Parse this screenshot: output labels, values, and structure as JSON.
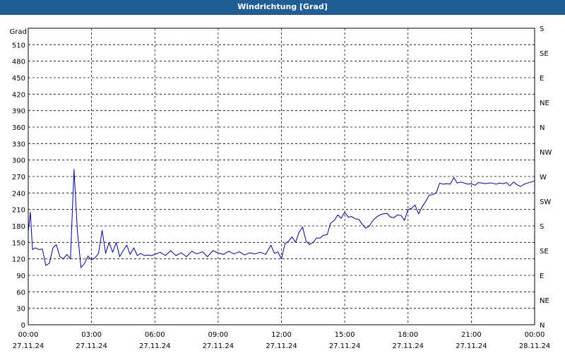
{
  "window": {
    "title": "Windrichtung [Grad]"
  },
  "chart_data": {
    "type": "line",
    "ylabel": "Grad",
    "ylim": [
      0,
      540
    ],
    "yticks": [
      0,
      30,
      60,
      90,
      120,
      150,
      180,
      210,
      240,
      270,
      300,
      330,
      360,
      390,
      420,
      450,
      480,
      510
    ],
    "right_axis_labels": [
      "N",
      "NE",
      "E",
      "SE",
      "S",
      "SW",
      "W",
      "NW",
      "N",
      "NE",
      "E",
      "SE",
      "S"
    ],
    "xlim_hours": [
      0,
      24
    ],
    "xticks": [
      {
        "hour": 0,
        "time": "00:00",
        "date": "27.11.24"
      },
      {
        "hour": 3,
        "time": "03:00",
        "date": "27.11.24"
      },
      {
        "hour": 6,
        "time": "06:00",
        "date": "27.11.24"
      },
      {
        "hour": 9,
        "time": "09:00",
        "date": "27.11.24"
      },
      {
        "hour": 12,
        "time": "12:00",
        "date": "27.11.24"
      },
      {
        "hour": 15,
        "time": "15:00",
        "date": "27.11.24"
      },
      {
        "hour": 18,
        "time": "18:00",
        "date": "27.11.24"
      },
      {
        "hour": 21,
        "time": "21:00",
        "date": "27.11.24"
      },
      {
        "hour": 24,
        "time": "00:00",
        "date": "28.11.24"
      }
    ],
    "grid": true,
    "line_color": "#00008b",
    "series": [
      {
        "x": [
          0,
          0.1,
          0.2,
          0.33,
          0.5,
          0.67,
          0.83,
          1.0,
          1.17,
          1.33,
          1.5,
          1.67,
          1.83,
          2.0,
          2.17,
          2.33,
          2.5,
          2.67,
          2.83,
          3.0,
          3.17,
          3.33,
          3.5,
          3.67,
          3.83,
          4.0,
          4.17,
          4.33,
          4.5,
          4.67,
          4.83,
          5.0,
          5.17,
          5.33,
          5.5,
          5.67,
          5.83,
          6.0,
          6.25,
          6.5,
          6.75,
          7.0,
          7.25,
          7.5,
          7.75,
          8.0,
          8.25,
          8.5,
          8.75,
          9.0,
          9.25,
          9.5,
          9.75,
          10.0,
          10.25,
          10.5,
          10.75,
          11.0,
          11.25,
          11.5,
          11.67,
          11.83,
          12.0,
          12.17,
          12.33,
          12.5,
          12.67,
          12.83,
          13.0,
          13.17,
          13.33,
          13.5,
          13.67,
          13.83,
          14.0,
          14.17,
          14.33,
          14.5,
          14.67,
          14.83,
          15.0,
          15.17,
          15.33,
          15.5,
          15.67,
          15.83,
          16.0,
          16.17,
          16.33,
          16.5,
          16.67,
          16.83,
          17.0,
          17.17,
          17.33,
          17.5,
          17.67,
          17.83,
          18.0,
          18.17,
          18.33,
          18.5,
          18.67,
          18.83,
          19.0,
          19.17,
          19.33,
          19.5,
          19.67,
          19.83,
          20.0,
          20.17,
          20.33,
          20.5,
          20.67,
          20.83,
          21.0,
          21.17,
          21.33,
          21.5,
          21.67,
          21.83,
          22.0,
          22.17,
          22.33,
          22.5,
          22.67,
          22.83,
          23.0,
          23.17,
          23.33,
          23.5,
          23.67,
          23.83,
          24.0
        ],
        "y": [
          170,
          205,
          137,
          140,
          137,
          138,
          108,
          112,
          140,
          146,
          124,
          120,
          128,
          120,
          283,
          170,
          104,
          112,
          125,
          118,
          122,
          130,
          172,
          130,
          150,
          132,
          150,
          124,
          135,
          145,
          128,
          140,
          126,
          130,
          126,
          127,
          126,
          128,
          132,
          126,
          135,
          126,
          131,
          124,
          134,
          129,
          133,
          124,
          135,
          131,
          128,
          134,
          129,
          133,
          127,
          131,
          129,
          132,
          128,
          145,
          130,
          133,
          120,
          148,
          152,
          160,
          150,
          168,
          178,
          152,
          146,
          150,
          158,
          158,
          163,
          164,
          185,
          190,
          200,
          194,
          205,
          196,
          197,
          193,
          192,
          183,
          176,
          180,
          190,
          196,
          200,
          202,
          203,
          196,
          195,
          200,
          199,
          190,
          210,
          212,
          218,
          202,
          215,
          224,
          236,
          237,
          240,
          258,
          256,
          257,
          256,
          268,
          258,
          260,
          258,
          256,
          257,
          254,
          259,
          258,
          257,
          258,
          258,
          256,
          258,
          257,
          259,
          253,
          260,
          255,
          252,
          256,
          258,
          260,
          262
        ]
      }
    ]
  }
}
